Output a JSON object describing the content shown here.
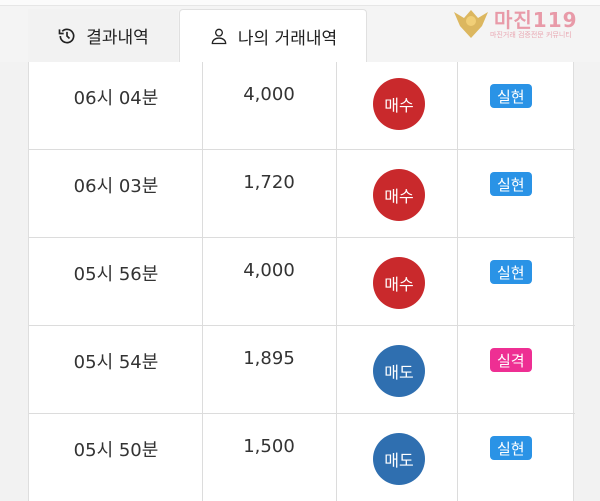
{
  "tabs": {
    "result_label": "결과내역",
    "mine_label": "나의 거래내역"
  },
  "logo": {
    "title": "마진119",
    "subtitle": "마진거래 검증전문 커뮤니티"
  },
  "colors": {
    "buy": "#c9292c",
    "sell": "#2f6fb0",
    "profit_badge": "#2a93e6",
    "loss_badge": "#ee2f93"
  },
  "rows": [
    {
      "time": "06시 04분",
      "amount": "4,000",
      "trade": "매수",
      "result": "실현"
    },
    {
      "time": "06시 03분",
      "amount": "1,720",
      "trade": "매수",
      "result": "실현"
    },
    {
      "time": "05시 56분",
      "amount": "4,000",
      "trade": "매수",
      "result": "실현"
    },
    {
      "time": "05시 54분",
      "amount": "1,895",
      "trade": "매도",
      "result": "실격"
    },
    {
      "time": "05시 50분",
      "amount": "1,500",
      "trade": "매도",
      "result": "실현"
    }
  ]
}
